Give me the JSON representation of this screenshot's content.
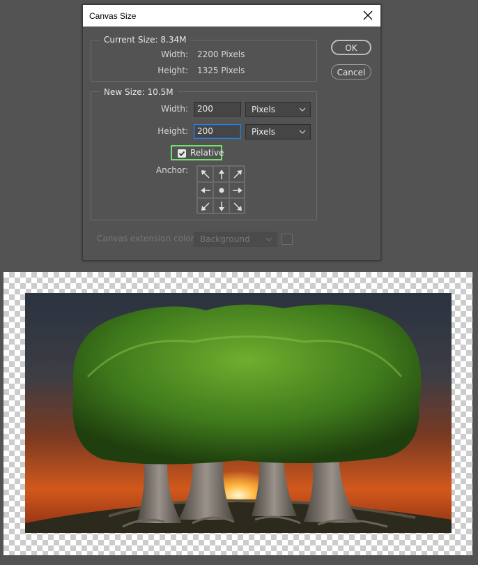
{
  "dialog": {
    "title": "Canvas Size",
    "current_size": {
      "label": "Current Size: 8.34M",
      "width_label": "Width:",
      "width_value": "2200 Pixels",
      "height_label": "Height:",
      "height_value": "1325 Pixels"
    },
    "new_size": {
      "label": "New Size: 10.5M",
      "width_label": "Width:",
      "width_value": "200",
      "width_unit": "Pixels",
      "height_label": "Height:",
      "height_value": "200",
      "height_unit": "Pixels",
      "relative_label": "Relative",
      "relative_checked": true,
      "anchor_label": "Anchor:"
    },
    "extension": {
      "label": "Canvas extension color:",
      "value": "Background"
    },
    "buttons": {
      "ok": "OK",
      "cancel": "Cancel"
    }
  },
  "icons": [
    "close-icon",
    "chevron-down-icon",
    "checkmark-icon",
    "arrow-icons",
    "anchor-dot-icon"
  ],
  "colors": {
    "workspace": "#535353",
    "relative_highlight": "#6ee36c",
    "focus_border": "#2f7fd4"
  }
}
